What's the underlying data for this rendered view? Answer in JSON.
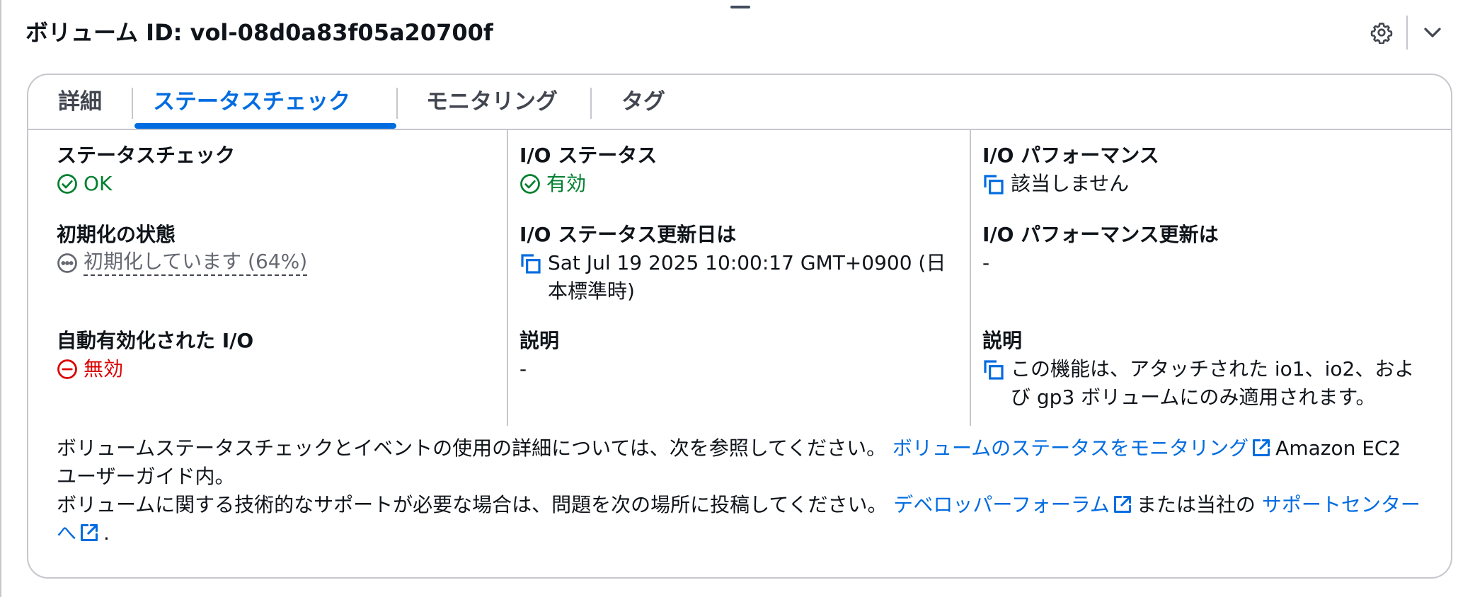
{
  "header": {
    "title": "ボリューム ID: vol-08d0a83f05a20700f"
  },
  "tabs": [
    {
      "label": "詳細",
      "active": false
    },
    {
      "label": "ステータスチェック",
      "active": true
    },
    {
      "label": "モニタリング",
      "active": false
    },
    {
      "label": "タグ",
      "active": false
    }
  ],
  "columns": {
    "col1": {
      "status_check": {
        "label": "ステータスチェック",
        "value": "OK",
        "status": "success"
      },
      "init_state": {
        "label": "初期化の状態",
        "value": "初期化しています (64%)",
        "status": "in-progress"
      },
      "auto_io": {
        "label": "自動有効化された I/O",
        "value": "無効",
        "status": "error"
      }
    },
    "col2": {
      "io_status": {
        "label": "I/O ステータス",
        "value": "有効",
        "status": "success"
      },
      "io_updated": {
        "label": "I/O ステータス更新日は",
        "value": "Sat Jul 19 2025 10:00:17 GMT+0900 (日本標準時)"
      },
      "description": {
        "label": "説明",
        "value": "-"
      }
    },
    "col3": {
      "io_performance": {
        "label": "I/O パフォーマンス",
        "value": "該当しません"
      },
      "perf_updated": {
        "label": "I/O パフォーマンス更新は",
        "value": "-"
      },
      "description": {
        "label": "説明",
        "value": "この機能は、アタッチされた io1、io2、および gp3 ボリュームにのみ適用されます。"
      }
    }
  },
  "footer": {
    "line1_text": "ボリュームステータスチェックとイベントの使用の詳細については、次を参照してください。",
    "line1_link": "ボリュームのステータスをモニタリング",
    "line1_suffix": "Amazon EC2 ユーザーガイド内。",
    "line2_text": "ボリュームに関する技術的なサポートが必要な場合は、問題を次の場所に投稿してください。",
    "line2_link1": "デベロッパーフォーラム",
    "line2_mid": "または当社の",
    "line2_link2": "サポートセンターへ",
    "line2_end": "."
  },
  "icons": {
    "settings": "gear-icon",
    "collapse": "chevron-down-icon",
    "success": "check-circle-icon",
    "in_progress": "ellipsis-circle-icon",
    "error": "minus-circle-icon",
    "copy": "copy-icon",
    "external": "external-link-icon"
  },
  "colors": {
    "link": "#006ce0",
    "success": "#00802f",
    "error": "#db0000",
    "muted": "#656871",
    "border": "#c6c6cd"
  }
}
